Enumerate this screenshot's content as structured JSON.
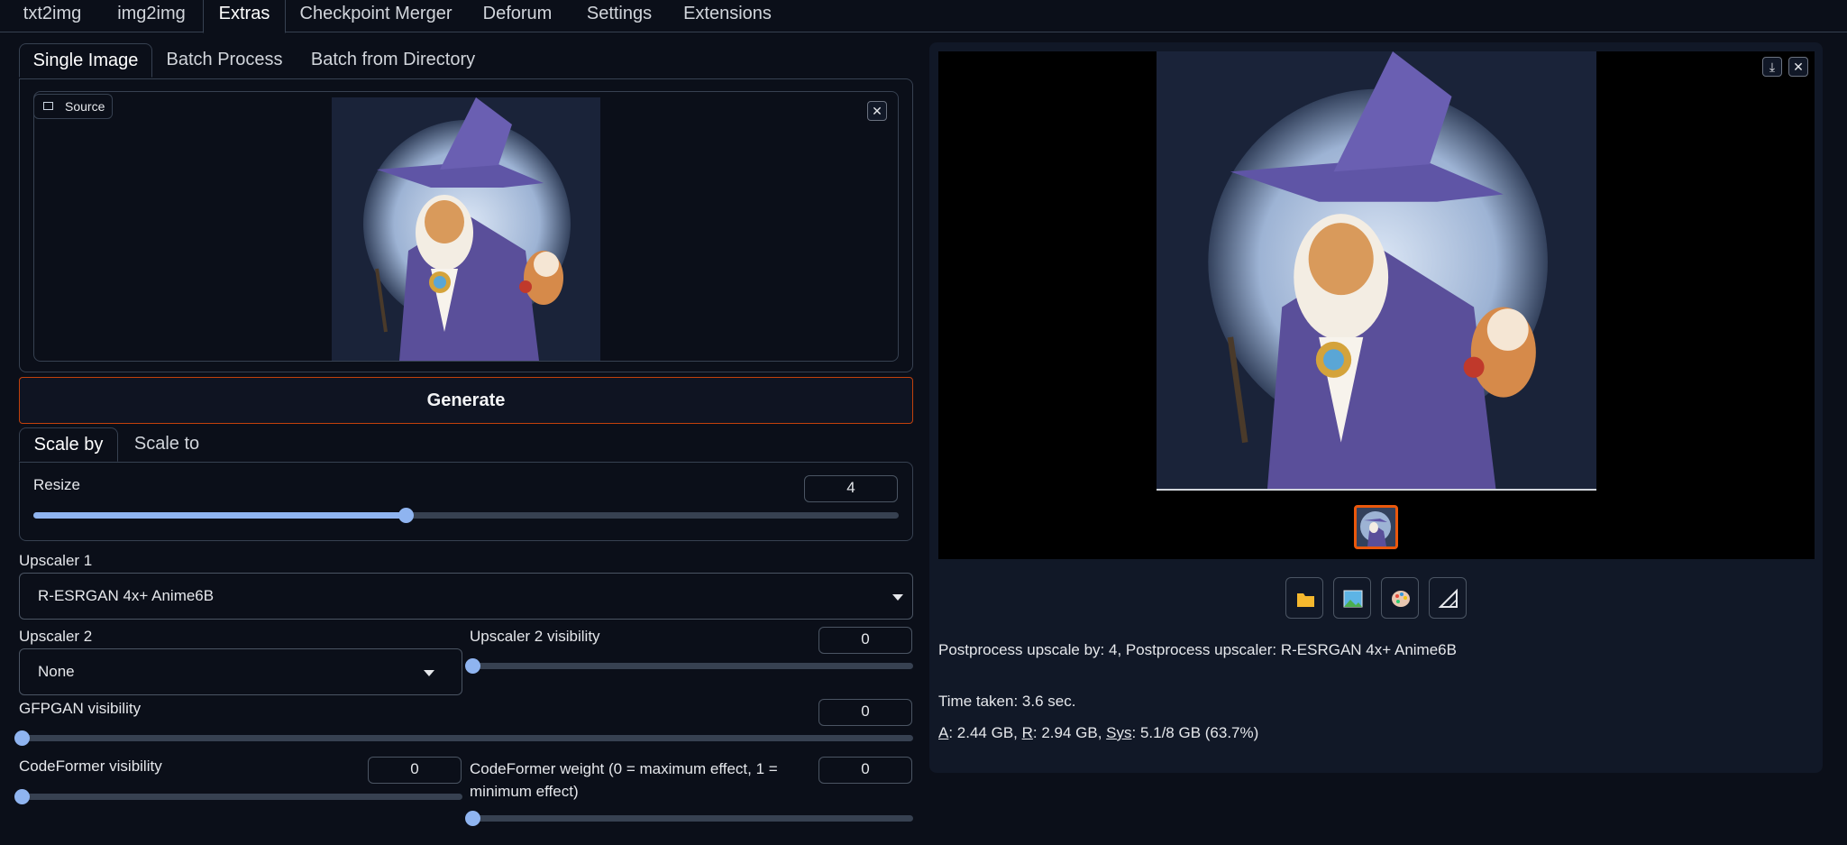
{
  "top_tabs": [
    "txt2img",
    "img2img",
    "Extras",
    "Checkpoint Merger",
    "Deforum",
    "Settings",
    "Extensions"
  ],
  "sub_tabs": [
    "Single Image",
    "Batch Process",
    "Batch from Directory"
  ],
  "source": {
    "label": "Source"
  },
  "generate_label": "Generate",
  "scale_tabs": [
    "Scale by",
    "Scale to"
  ],
  "resize": {
    "label": "Resize",
    "value": "4",
    "fraction": 0.43
  },
  "upscaler1": {
    "label": "Upscaler 1",
    "value": "R-ESRGAN 4x+ Anime6B"
  },
  "upscaler2": {
    "label": "Upscaler 2",
    "value": "None"
  },
  "upscaler2_visibility": {
    "label": "Upscaler 2 visibility",
    "value": "0",
    "fraction": 0
  },
  "gfpgan": {
    "label": "GFPGAN visibility",
    "value": "0",
    "fraction": 0
  },
  "codeformer_visibility": {
    "label": "CodeFormer visibility",
    "value": "0",
    "fraction": 0
  },
  "codeformer_weight": {
    "label_line1": "CodeFormer weight (0 = maximum effect, 1 =",
    "label_line2": "minimum effect)",
    "value": "0",
    "fraction": 0
  },
  "output": {
    "info": "Postprocess upscale by: 4, Postprocess upscaler: R-ESRGAN 4x+ Anime6B",
    "time_taken": "Time taken: 3.6 sec.",
    "mem_a_key": "A",
    "mem_a": ": 2.44 GB, ",
    "mem_r_key": "R",
    "mem_r": ": 2.94 GB, ",
    "mem_sys_key": "Sys",
    "mem_sys": ": 5.1/8 GB (63.7%)"
  },
  "icons": [
    "folder-icon",
    "image-icon",
    "palette-icon",
    "ruler-icon",
    "download-icon",
    "close-icon"
  ],
  "colors": {
    "background": "#0b0f19",
    "slider": "#8fb4f0",
    "generate_border": "#c2410c",
    "thumbnail_border": "#ea580c"
  }
}
